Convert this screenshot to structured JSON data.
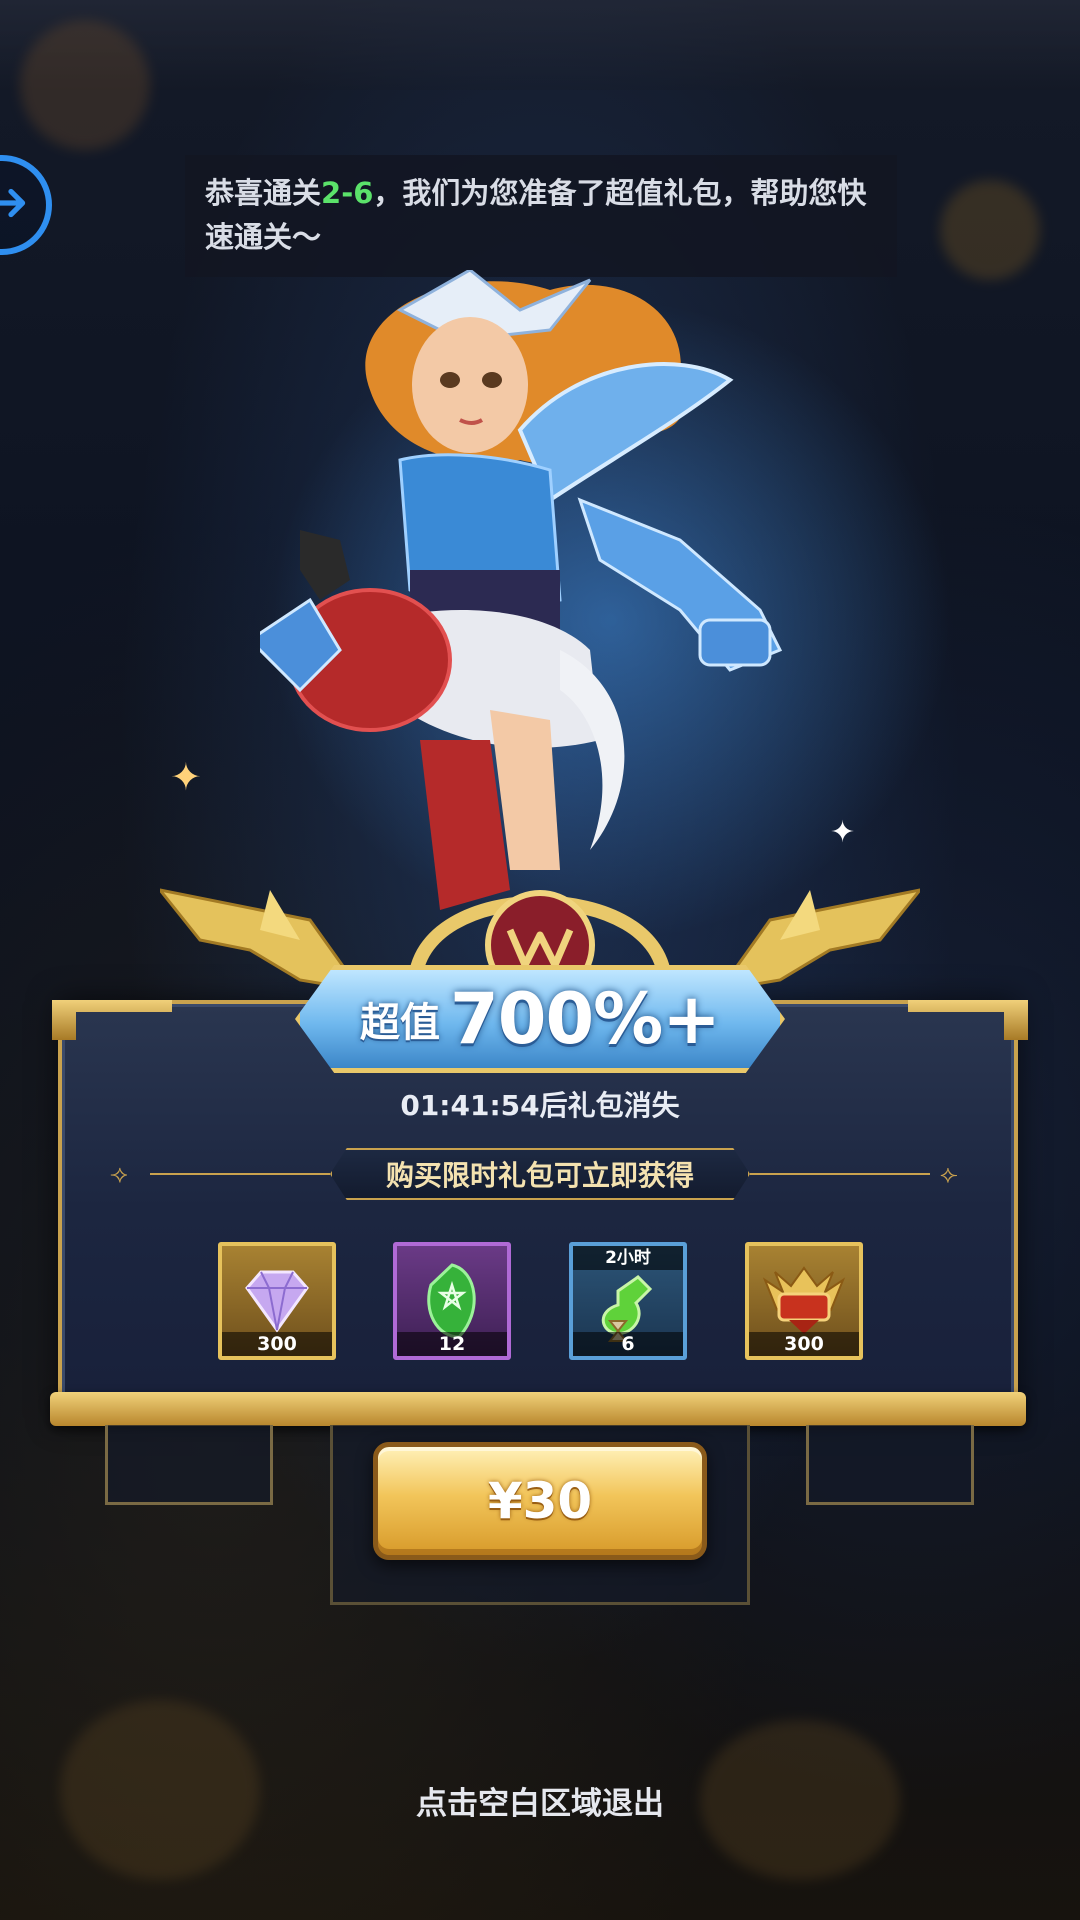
{
  "popup": {
    "message_prefix": "恭喜通关",
    "stage": "2-6",
    "message_suffix": "，我们为您准备了超值礼包，帮助您快速通关～",
    "value_label": "超值",
    "value_number": "700%+",
    "timer_text": "01:41:54后礼包消失",
    "subtitle": "购买限时礼包可立即获得",
    "price_label": "¥30",
    "exit_hint": "点击空白区域退出",
    "emblem_icon": "saint-emblem-icon",
    "back_icon": "arrow-right-circle-icon",
    "items": [
      {
        "name": "diamond",
        "icon": "diamond-gem-icon",
        "count": "300",
        "tag": "",
        "frame": "#d8b14f"
      },
      {
        "name": "green-rune-stone",
        "icon": "pentagram-stone-icon",
        "count": "12",
        "tag": "",
        "frame": "#b06ad6"
      },
      {
        "name": "exp-potion",
        "icon": "potion-hourglass-icon",
        "count": "6",
        "tag": "2小时",
        "frame": "#5a9fd8"
      },
      {
        "name": "vip-badge",
        "icon": "vip-shield-icon",
        "count": "300",
        "tag": "",
        "frame": "#d8b14f"
      }
    ]
  },
  "colors": {
    "accent_gold": "#c9a24e",
    "highlight_green": "#5be26a",
    "back_button_blue": "#2f8ff0"
  }
}
